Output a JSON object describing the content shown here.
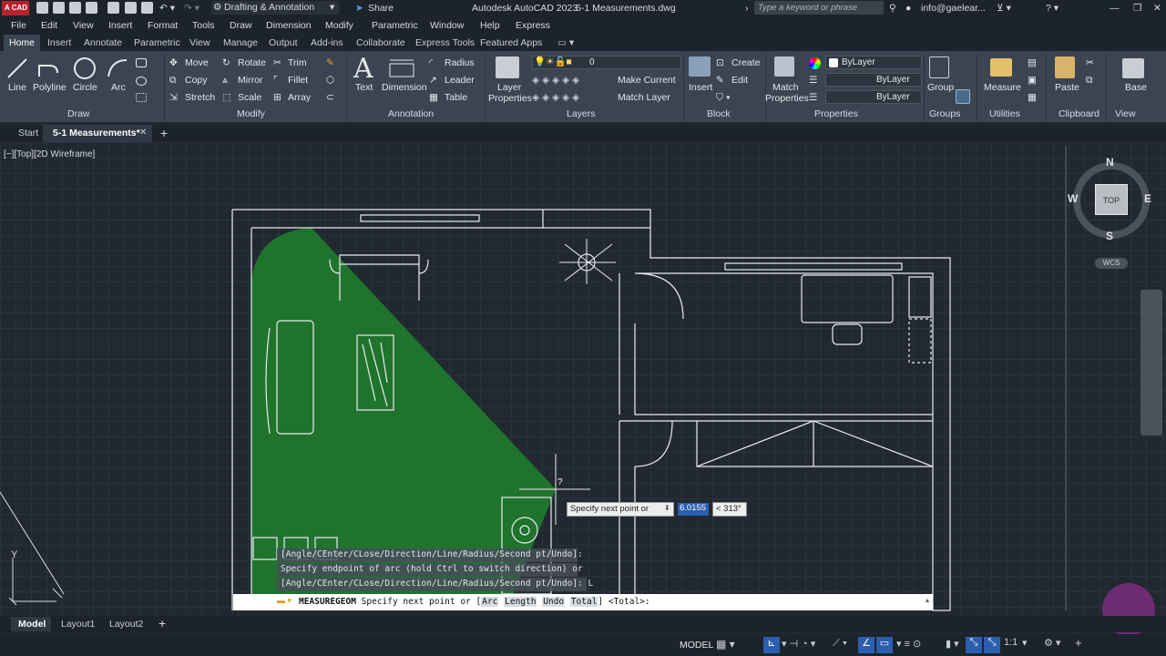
{
  "title_bar": {
    "logo_text": "A CAD",
    "workspace": "Drafting & Annotation",
    "share_label": "Share",
    "app_title": "Autodesk AutoCAD 2023",
    "file_title": "5-1 Measurements.dwg",
    "search_placeholder": "Type a keyword or phrase",
    "user": "info@gaelear..."
  },
  "menu": [
    "File",
    "Edit",
    "View",
    "Insert",
    "Format",
    "Tools",
    "Draw",
    "Dimension",
    "Modify",
    "Parametric",
    "Window",
    "Help",
    "Express"
  ],
  "ribbon_tabs": [
    "Home",
    "Insert",
    "Annotate",
    "Parametric",
    "View",
    "Manage",
    "Output",
    "Add-ins",
    "Collaborate",
    "Express Tools",
    "Featured Apps"
  ],
  "active_ribbon_tab": "Home",
  "ribbon": {
    "draw": {
      "title": "Draw",
      "tools": [
        "Line",
        "Polyline",
        "Circle",
        "Arc"
      ]
    },
    "modify": {
      "title": "Modify",
      "tools": [
        "Move",
        "Rotate",
        "Trim",
        "Copy",
        "Mirror",
        "Fillet",
        "Stretch",
        "Scale",
        "Array"
      ]
    },
    "annotation": {
      "title": "Annotation",
      "tools": [
        "Text",
        "Dimension",
        "Radius",
        "Leader",
        "Table"
      ]
    },
    "layers": {
      "title": "Layers",
      "layer_properties": "Layer Properties",
      "current_layer": "0",
      "make_current": "Make Current",
      "match_layer": "Match Layer"
    },
    "block": {
      "title": "Block",
      "insert": "Insert",
      "create": "Create",
      "edit": "Edit"
    },
    "properties": {
      "title": "Properties",
      "match": "Match Properties",
      "color": "ByLayer",
      "linetype": "ByLayer",
      "lineweight": "ByLayer"
    },
    "groups": {
      "title": "Groups",
      "group": "Group"
    },
    "utilities": {
      "title": "Utilities",
      "measure": "Measure"
    },
    "clipboard": {
      "title": "Clipboard",
      "paste": "Paste"
    },
    "view": {
      "title": "View",
      "base": "Base"
    }
  },
  "file_tabs": {
    "start": "Start",
    "active": "5-1 Measurements*"
  },
  "viewport_label": "[−][Top][2D Wireframe]",
  "viewcube": {
    "n": "N",
    "s": "S",
    "e": "E",
    "w": "W",
    "face": "TOP",
    "wcs": "WCS"
  },
  "command_history": [
    "[Angle/CEnter/CLose/Direction/Line/Radius/Second pt/Undo]:",
    "Specify endpoint of arc (hold Ctrl to switch direction) or",
    "[Angle/CEnter/CLose/Direction/Line/Radius/Second pt/Undo]: L"
  ],
  "command_line": {
    "command": "MEASUREGEOM",
    "prompt": "Specify next point or [",
    "options": [
      "Arc",
      "Length",
      "Undo",
      "Total"
    ],
    "suffix": "] <Total>:"
  },
  "dynamic_input": {
    "prompt": "Specify next point or",
    "distance": "6.0155",
    "angle": "< 313°"
  },
  "cursor_marker": "?",
  "layout_tabs": [
    "Model",
    "Layout1",
    "Layout2"
  ],
  "status": {
    "model": "MODEL",
    "scale": "1:1"
  },
  "colors": {
    "measure_fill": "#1f7a2e",
    "accent": "#2a5fb0",
    "background": "#212830"
  }
}
